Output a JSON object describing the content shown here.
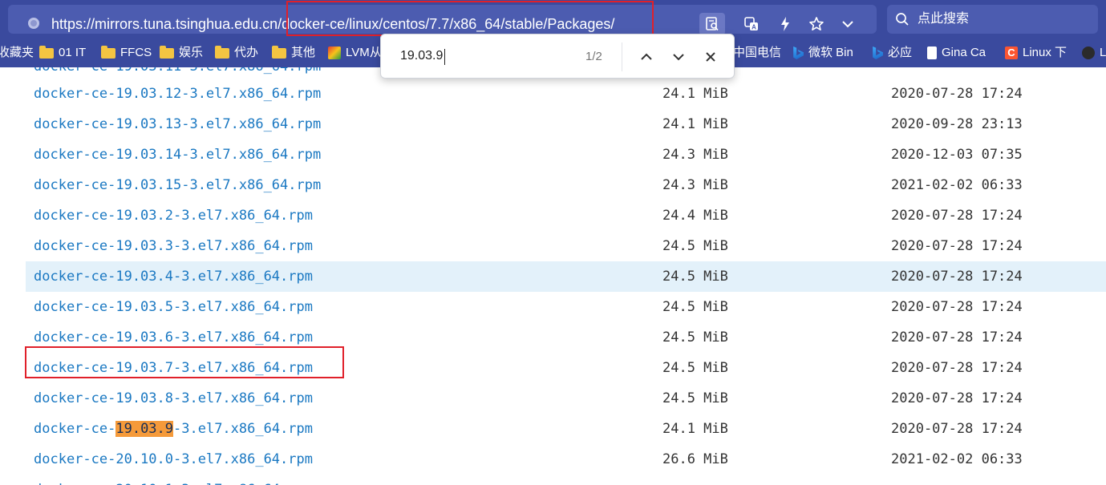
{
  "address_bar": {
    "url_prefix": "https://mirrors.tuna.tsinghua.edu.cn",
    "url_path": "/docker-ce/linux/centos/7.7/x86_64/stable/Packages/"
  },
  "toolbar": {
    "search_placeholder": "点此搜索",
    "icons": [
      "reader-mode-icon",
      "translate-icon",
      "lightning-icon",
      "star-icon",
      "chevron-down-icon"
    ]
  },
  "bookmarks": [
    {
      "label": "收藏夹",
      "icon": "none"
    },
    {
      "label": "01 IT",
      "icon": "folder-icon"
    },
    {
      "label": "FFCS",
      "icon": "folder-icon"
    },
    {
      "label": "娱乐",
      "icon": "folder-icon"
    },
    {
      "label": "代办",
      "icon": "folder-icon"
    },
    {
      "label": "其他",
      "icon": "folder-icon"
    },
    {
      "label": "LVM从",
      "icon": "site-icon"
    },
    {
      "label": "中国电信",
      "icon": "none"
    },
    {
      "label": "微软 Bin",
      "icon": "bing-icon"
    },
    {
      "label": "必应",
      "icon": "bing-icon"
    },
    {
      "label": "Gina Ca",
      "icon": "page-icon"
    },
    {
      "label": "Linux 下",
      "icon": "c-icon"
    },
    {
      "label": "L",
      "icon": "site-icon"
    }
  ],
  "find_bar": {
    "query": "19.03.9",
    "count": "1/2"
  },
  "files": [
    {
      "name": "docker-ce-19.03.12-3.el7.x86_64.rpm",
      "size": "24.1 MiB",
      "date": "2020-07-28 17:24"
    },
    {
      "name": "docker-ce-19.03.13-3.el7.x86_64.rpm",
      "size": "24.1 MiB",
      "date": "2020-09-28 23:13"
    },
    {
      "name": "docker-ce-19.03.14-3.el7.x86_64.rpm",
      "size": "24.3 MiB",
      "date": "2020-12-03 07:35"
    },
    {
      "name": "docker-ce-19.03.15-3.el7.x86_64.rpm",
      "size": "24.3 MiB",
      "date": "2021-02-02 06:33"
    },
    {
      "name": "docker-ce-19.03.2-3.el7.x86_64.rpm",
      "size": "24.4 MiB",
      "date": "2020-07-28 17:24"
    },
    {
      "name": "docker-ce-19.03.3-3.el7.x86_64.rpm",
      "size": "24.5 MiB",
      "date": "2020-07-28 17:24"
    },
    {
      "name": "docker-ce-19.03.4-3.el7.x86_64.rpm",
      "size": "24.5 MiB",
      "date": "2020-07-28 17:24"
    },
    {
      "name": "docker-ce-19.03.5-3.el7.x86_64.rpm",
      "size": "24.5 MiB",
      "date": "2020-07-28 17:24"
    },
    {
      "name": "docker-ce-19.03.6-3.el7.x86_64.rpm",
      "size": "24.5 MiB",
      "date": "2020-07-28 17:24"
    },
    {
      "name": "docker-ce-19.03.7-3.el7.x86_64.rpm",
      "size": "24.5 MiB",
      "date": "2020-07-28 17:24"
    },
    {
      "name": "docker-ce-19.03.8-3.el7.x86_64.rpm",
      "size": "24.5 MiB",
      "date": "2020-07-28 17:24"
    },
    {
      "name": "docker-ce-19.03.9-3.el7.x86_64.rpm",
      "name_parts": [
        "docker-ce-",
        "19.03.9",
        "-3.el7.x86_64.rpm"
      ],
      "size": "24.1 MiB",
      "date": "2020-07-28 17:24"
    },
    {
      "name": "docker-ce-20.10.0-3.el7.x86_64.rpm",
      "size": "26.6 MiB",
      "date": "2021-02-02 06:33"
    }
  ],
  "colors": {
    "chrome_bg": "#3a4a9e",
    "link": "#1a78c2",
    "hover_row": "#e3f1fa",
    "find_match": "#f59a3a",
    "annotation_red": "#e0202a"
  }
}
